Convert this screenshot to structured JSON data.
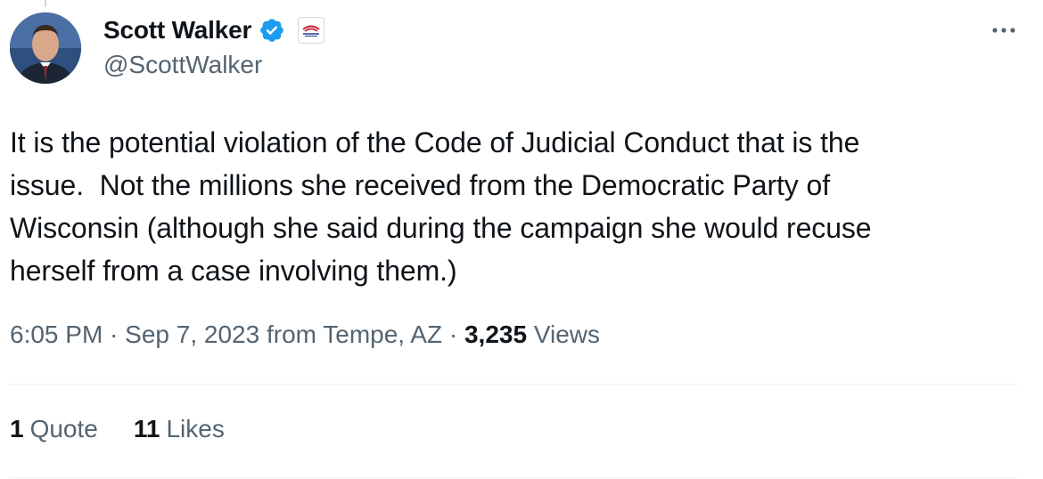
{
  "author": {
    "display_name": "Scott Walker",
    "handle": "@ScottWalker",
    "verified_color": "#1d9bf0",
    "verified_icon": "verified-badge-icon",
    "affiliate_icon": "affiliate-badge-icon",
    "avatar_icon": "avatar"
  },
  "more_icon": "more-options-icon",
  "tweet": {
    "text": "It is the potential violation of the Code of Judicial Conduct that is the\nissue.  Not the millions she received from the Democratic Party of\nWisconsin (although she said during the campaign she would recuse\nherself from a case involving them.)",
    "time": "6:05 PM",
    "separator": " · ",
    "date_location": "Sep 7, 2023 from Tempe, AZ",
    "views_count": "3,235",
    "views_label": "Views"
  },
  "stats": {
    "quotes_count": "1",
    "quotes_label": "Quote",
    "likes_count": "11",
    "likes_label": "Likes"
  }
}
